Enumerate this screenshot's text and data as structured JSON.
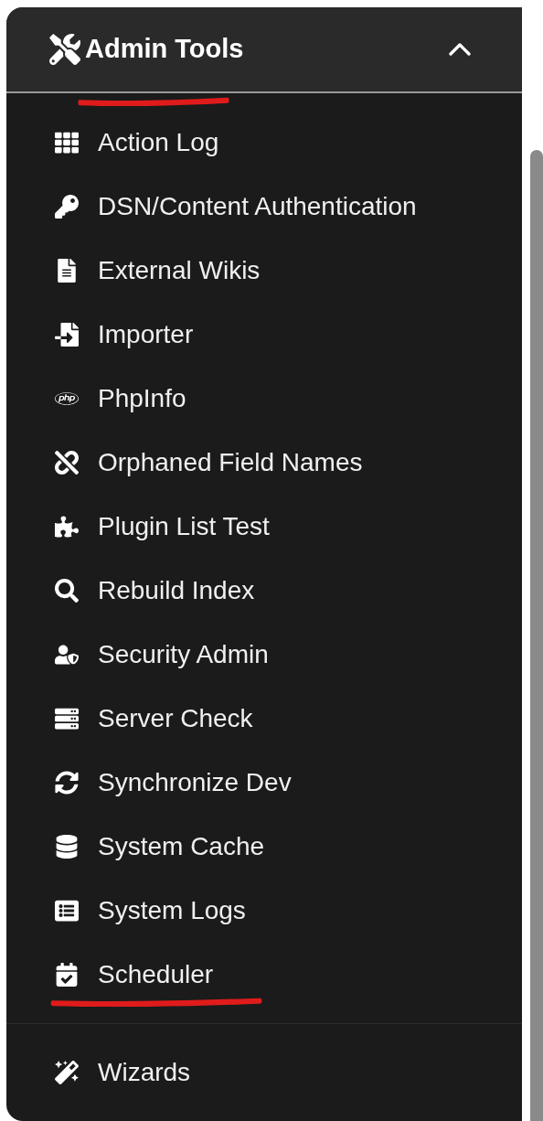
{
  "header": {
    "title": "Admin Tools",
    "expanded": true,
    "underlined": true
  },
  "sections": [
    {
      "items": [
        {
          "label": "Action Log",
          "underlined": false
        },
        {
          "label": "DSN/Content Authentication",
          "underlined": false
        },
        {
          "label": "External Wikis",
          "underlined": false
        },
        {
          "label": "Importer",
          "underlined": false
        },
        {
          "label": "PhpInfo",
          "underlined": false
        },
        {
          "label": "Orphaned Field Names",
          "underlined": false
        },
        {
          "label": "Plugin List Test",
          "underlined": false
        },
        {
          "label": "Rebuild Index",
          "underlined": false
        },
        {
          "label": "Security Admin",
          "underlined": false
        },
        {
          "label": "Server Check",
          "underlined": false
        },
        {
          "label": "Synchronize Dev",
          "underlined": false
        },
        {
          "label": "System Cache",
          "underlined": false
        },
        {
          "label": "System Logs",
          "underlined": false
        },
        {
          "label": "Scheduler",
          "underlined": true
        }
      ]
    },
    {
      "items": [
        {
          "label": "Wizards",
          "underlined": false
        }
      ]
    }
  ]
}
